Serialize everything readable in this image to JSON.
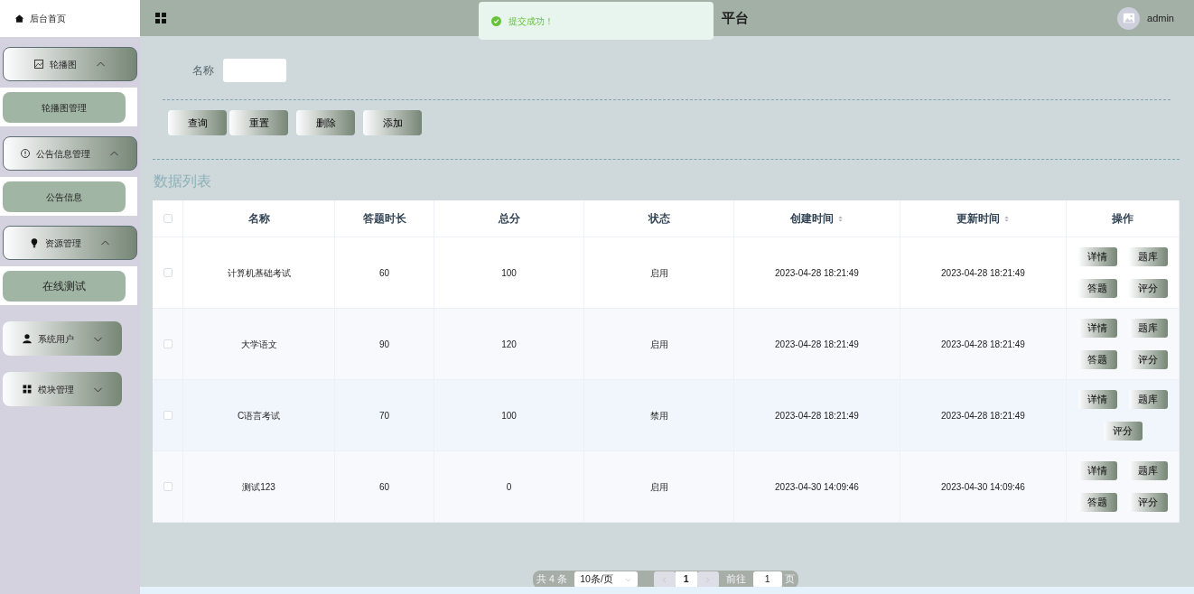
{
  "header": {
    "title": "平台",
    "user": "admin"
  },
  "toast": {
    "message": "提交成功！"
  },
  "sidebar": [
    {
      "kind": "link",
      "label": "后台首页"
    },
    {
      "kind": "group",
      "label": "轮播图",
      "expanded": true,
      "children": [
        {
          "label": "轮播图管理",
          "selected": false
        }
      ]
    },
    {
      "kind": "group",
      "label": "公告信息管理",
      "expanded": true,
      "children": [
        {
          "label": "公告信息",
          "selected": false
        }
      ]
    },
    {
      "kind": "group",
      "label": "资源管理",
      "expanded": true,
      "children": [
        {
          "label": "在线测试",
          "selected": true
        }
      ]
    },
    {
      "kind": "group",
      "label": "系统用户",
      "expanded": false
    },
    {
      "kind": "group",
      "label": "模块管理",
      "expanded": false
    }
  ],
  "search": {
    "label": "名称"
  },
  "actions": [
    "查询",
    "重置",
    "删除",
    "添加"
  ],
  "section_title": "数据列表",
  "table": {
    "select_all": {
      "checked": false
    },
    "columns": [
      {
        "label": "名称",
        "sortable": false
      },
      {
        "label": "答题时长",
        "sortable": false
      },
      {
        "label": "总分",
        "sortable": false
      },
      {
        "label": "状态",
        "sortable": false
      },
      {
        "label": "创建时间",
        "sortable": true
      },
      {
        "label": "更新时间",
        "sortable": true
      },
      {
        "label": "操作",
        "sortable": false
      }
    ],
    "rows": [
      {
        "checked": false,
        "cells": [
          "计算机基础考试",
          "60",
          "100",
          "启用",
          "2023-04-28 18:21:49",
          "2023-04-28 18:21:49"
        ],
        "buttons": [
          "详情",
          "题库",
          "答题",
          "评分"
        ]
      },
      {
        "checked": false,
        "cells": [
          "大学语文",
          "90",
          "120",
          "启用",
          "2023-04-28 18:21:49",
          "2023-04-28 18:21:49"
        ],
        "buttons": [
          "详情",
          "题库",
          "答题",
          "评分"
        ]
      },
      {
        "checked": false,
        "cells": [
          "C语言考试",
          "70",
          "100",
          "禁用",
          "2023-04-28 18:21:49",
          "2023-04-28 18:21:49"
        ],
        "buttons": [
          "详情",
          "题库",
          "评分"
        ]
      },
      {
        "checked": false,
        "cells": [
          "测试123",
          "60",
          "0",
          "启用",
          "2023-04-30 14:09:46",
          "2023-04-30 14:09:46"
        ],
        "buttons": [
          "详情",
          "题库",
          "答题",
          "评分"
        ]
      }
    ]
  },
  "pagination": {
    "total": "共 4 条",
    "page_size": "10条/页",
    "current": "1",
    "goto_label": "前往",
    "goto_value": "1",
    "page_unit": "页"
  }
}
